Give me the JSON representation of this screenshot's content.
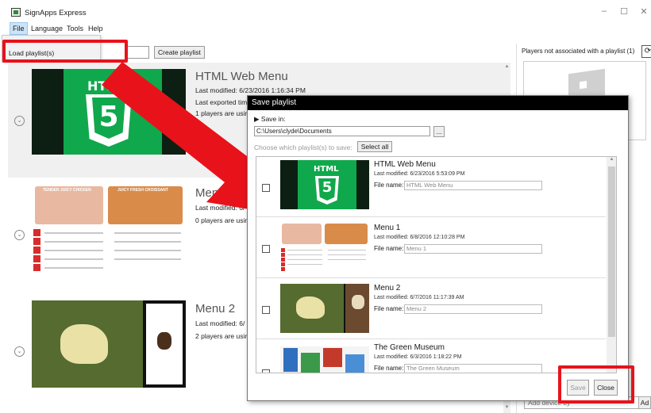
{
  "window": {
    "title": "SignApps Express",
    "minimize": "–",
    "maximize": "☐",
    "close": "✕"
  },
  "menu": {
    "items": [
      "File",
      "Language",
      "Tools",
      "Help"
    ],
    "file_dropdown": {
      "load": "Load playlist(s)"
    }
  },
  "playlist_bar": {
    "create_button": "Create playlist"
  },
  "playlists": [
    {
      "name": "HTML Web Menu",
      "last_modified": "Last modified: 6/23/2016 1:16:34 PM",
      "last_exported": "Last exported tim",
      "players": "1 players are usin"
    },
    {
      "name": "Menu 1",
      "last_modified": "Last modified: 6/",
      "players": "0 players are usin"
    },
    {
      "name": "Menu 2",
      "last_modified": "Last modified: 6/",
      "players": "2 players are usin"
    }
  ],
  "right_panel": {
    "title": "Players not associated with a playlist (1)",
    "add_device_placeholder": "Add device by",
    "add_button": "Ad"
  },
  "dialog": {
    "title": "Save playlist",
    "save_in_label": "▶ Save in:",
    "path": "C:\\Users\\clyde\\Documents",
    "browse": "...",
    "choose_label": "Choose which playlist(s) to save:",
    "select_all": "Select all",
    "file_name_label": "File name:",
    "items": [
      {
        "name": "HTML Web Menu",
        "modified": "Last modified: 6/23/2016 5:53:09 PM",
        "file": "HTML Web Menu",
        "checked": true
      },
      {
        "name": "Menu 1",
        "modified": "Last modified: 6/8/2016 12:10:28 PM",
        "file": "Menu 1",
        "checked": false
      },
      {
        "name": "Menu 2",
        "modified": "Last modified: 6/7/2016 11:17:39 AM",
        "file": "Menu 2",
        "checked": false
      },
      {
        "name": "The Green Museum",
        "modified": "Last modified: 6/3/2016 1:18:22 PM",
        "file": "The Green Museum",
        "checked": false
      }
    ],
    "save_button": "Save",
    "close_button": "Close"
  },
  "thumb_text": {
    "html5": "HTML",
    "five": "5",
    "menu_left": "TENDER JUICY CHICKEN",
    "menu_right": "JUICY FRESH CROISSANT"
  },
  "colors": {
    "highlight": "#e8121b",
    "html5_green": "#10a84c",
    "menu_red": "#d92b2b"
  }
}
